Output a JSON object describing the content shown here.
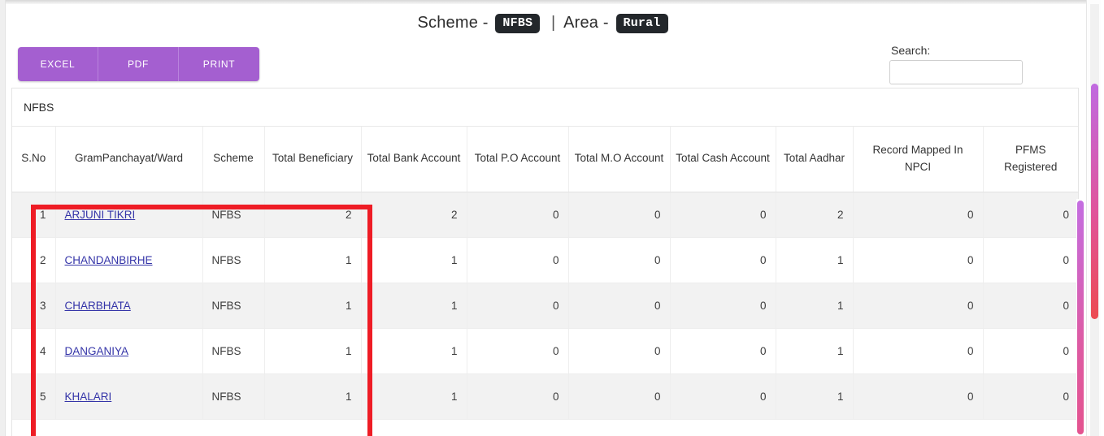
{
  "header": {
    "scheme_label": "Scheme -",
    "scheme_value": "NFBS",
    "separator": "|",
    "area_label": "Area -",
    "area_value": "Rural"
  },
  "toolbar": {
    "excel_label": "EXCEL",
    "pdf_label": "PDF",
    "print_label": "PRINT",
    "accent_color": "#a45fd0"
  },
  "search": {
    "label": "Search:",
    "value": "",
    "placeholder": ""
  },
  "table": {
    "caption": "NFBS",
    "columns": [
      "S.No",
      "GramPanchayat/Ward",
      "Scheme",
      "Total Beneficiary",
      "Total Bank Account",
      "Total P.O Account",
      "Total M.O Account",
      "Total Cash Account",
      "Total Aadhar",
      "Record Mapped In NPCI",
      "PFMS Registered"
    ],
    "rows": [
      {
        "sno": "1",
        "gram_panchayat": "ARJUNI TIKRI",
        "scheme": "NFBS",
        "total_beneficiary": "2",
        "total_bank_account": "2",
        "total_po_account": "0",
        "total_mo_account": "0",
        "total_cash_account": "0",
        "total_aadhar": "2",
        "record_mapped_npci": "0",
        "pfms_registered": "0"
      },
      {
        "sno": "2",
        "gram_panchayat": "CHANDANBIRHE",
        "scheme": "NFBS",
        "total_beneficiary": "1",
        "total_bank_account": "1",
        "total_po_account": "0",
        "total_mo_account": "0",
        "total_cash_account": "0",
        "total_aadhar": "1",
        "record_mapped_npci": "0",
        "pfms_registered": "0"
      },
      {
        "sno": "3",
        "gram_panchayat": "CHARBHATA",
        "scheme": "NFBS",
        "total_beneficiary": "1",
        "total_bank_account": "1",
        "total_po_account": "0",
        "total_mo_account": "0",
        "total_cash_account": "0",
        "total_aadhar": "1",
        "record_mapped_npci": "0",
        "pfms_registered": "0"
      },
      {
        "sno": "4",
        "gram_panchayat": "DANGANIYA",
        "scheme": "NFBS",
        "total_beneficiary": "1",
        "total_bank_account": "1",
        "total_po_account": "0",
        "total_mo_account": "0",
        "total_cash_account": "0",
        "total_aadhar": "1",
        "record_mapped_npci": "0",
        "pfms_registered": "0"
      },
      {
        "sno": "5",
        "gram_panchayat": "KHALARI",
        "scheme": "NFBS",
        "total_beneficiary": "1",
        "total_bank_account": "1",
        "total_po_account": "0",
        "total_mo_account": "0",
        "total_cash_account": "0",
        "total_aadhar": "1",
        "record_mapped_npci": "0",
        "pfms_registered": "0"
      }
    ]
  },
  "annotation": {
    "highlight_color": "#ee1c25"
  }
}
